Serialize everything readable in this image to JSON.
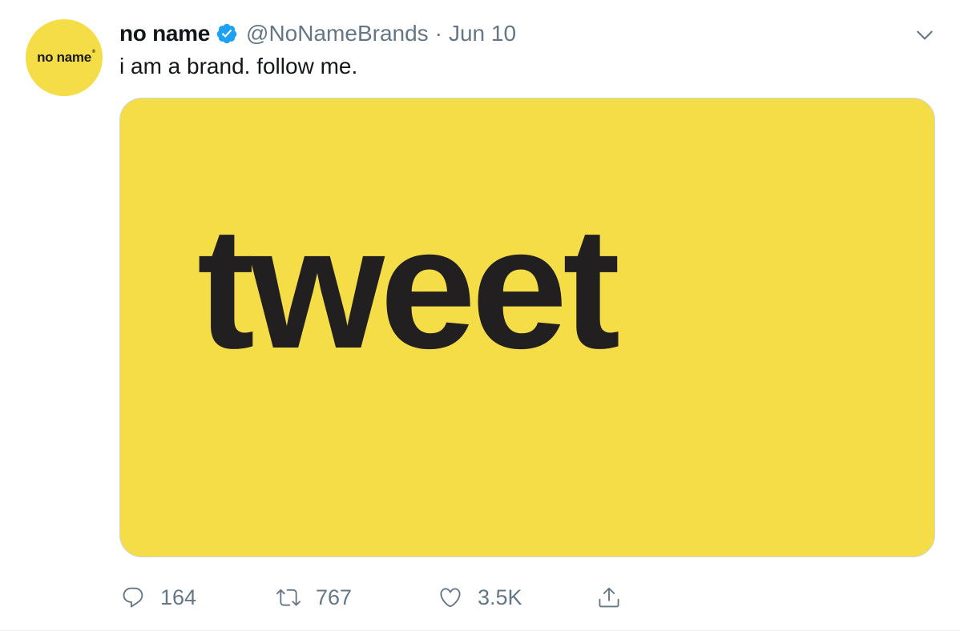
{
  "tweet": {
    "avatar_text": "no name",
    "display_name": "no name",
    "verified": true,
    "handle": "@NoNameBrands",
    "separator": "·",
    "date": "Jun 10",
    "text": "i am a brand. follow me.",
    "media_word": "tweet",
    "media_color": "#f5dd48"
  },
  "actions": {
    "reply_count": "164",
    "retweet_count": "767",
    "like_count": "3.5K"
  },
  "icons": {
    "reply": "reply-icon",
    "retweet": "retweet-icon",
    "like": "heart-icon",
    "share": "share-icon",
    "more": "chevron-down-icon",
    "verified": "verified-badge-icon"
  },
  "colors": {
    "accent": "#1da1f2",
    "muted": "#657786",
    "text": "#14171a",
    "brand_yellow": "#f5dd48"
  }
}
